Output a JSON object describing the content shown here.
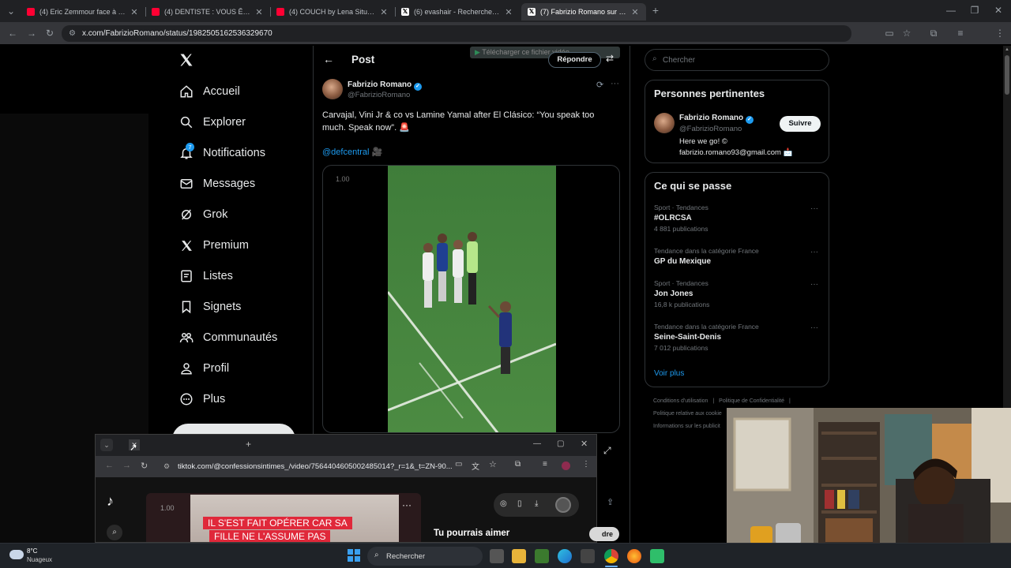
{
  "browser": {
    "tabs": [
      {
        "title": "(4) Eric Zemmour face à Pascal",
        "type": "yt"
      },
      {
        "title": "(4) DENTISTE : VOUS ÊTES SALE",
        "type": "yt"
      },
      {
        "title": "(4) COUCH by Lena Situations",
        "type": "yt"
      },
      {
        "title": "(6) evashair - Recherche / X",
        "type": "x"
      },
      {
        "title": "(7) Fabrizio Romano sur X : \"Ca",
        "type": "x"
      }
    ],
    "url": "x.com/FabrizioRomano/status/1982505162536329670"
  },
  "nav": {
    "items": [
      {
        "label": "Accueil",
        "icon": "home-icon"
      },
      {
        "label": "Explorer",
        "icon": "search-icon"
      },
      {
        "label": "Notifications",
        "icon": "bell-icon",
        "badge": "7"
      },
      {
        "label": "Messages",
        "icon": "mail-icon"
      },
      {
        "label": "Grok",
        "icon": "grok-icon"
      },
      {
        "label": "Premium",
        "icon": "x-icon"
      },
      {
        "label": "Listes",
        "icon": "list-icon"
      },
      {
        "label": "Signets",
        "icon": "bookmark-icon"
      },
      {
        "label": "Communautés",
        "icon": "communities-icon"
      },
      {
        "label": "Profil",
        "icon": "person-icon"
      },
      {
        "label": "Plus",
        "icon": "more-circle-icon"
      }
    ]
  },
  "post": {
    "header_title": "Post",
    "reply_button": "Répondre",
    "download_overlay": "Télécharger ce fichier vidéo",
    "author_name": "Fabrizio Romano",
    "author_handle": "@FabrizioRomano",
    "text": "Carvajal, Vini Jr & co vs Lamine Yamal after El Clásico: “You speak too much. Speak now”. 🚨",
    "mention": "@defcentral 🎥",
    "video_speed": "1.00"
  },
  "search": {
    "placeholder": "Chercher"
  },
  "relevant": {
    "title": "Personnes pertinentes",
    "name": "Fabrizio Romano",
    "handle": "@FabrizioRomano",
    "follow": "Suivre",
    "bio1": "Here we go! ©",
    "bio2": "fabrizio.romano93@gmail.com 📩"
  },
  "trends": {
    "title": "Ce qui se passe",
    "items": [
      {
        "category": "Sport · Tendances",
        "name": "#OLRCSA",
        "count": "4 881 publications"
      },
      {
        "category": "Tendance dans la catégorie France",
        "name": "GP du Mexique",
        "count": ""
      },
      {
        "category": "Sport · Tendances",
        "name": "Jon Jones",
        "count": "16,8 k publications"
      },
      {
        "category": "Tendance dans la catégorie France",
        "name": "Seine-Saint-Denis",
        "count": "7 012 publications"
      }
    ],
    "more": "Voir plus"
  },
  "footer": {
    "links": [
      "Conditions d'utilisation",
      "Politique de Confidentialité",
      "Politique relative aux cookie",
      "Informations sur les publicit"
    ]
  },
  "tiktok": {
    "url": "tiktok.com/@confessionsintimes_/video/7564404605002485014?_r=1&_t=ZN-90...",
    "speed": "1.00",
    "caption1": "IL S'EST FAIT OPÉRER CAR SA",
    "caption2": "FILLE NE L'ASSUME PAS",
    "suggest": "Tu pourrais aimer",
    "partial_btn": "dre"
  },
  "taskbar": {
    "temp": "8°C",
    "weather": "Nuageux",
    "search": "Rechercher"
  },
  "colors": {
    "x_blue": "#1d9bf0",
    "youtube_red": "#ff0033",
    "tiktok_caption_red": "#e0283a"
  }
}
